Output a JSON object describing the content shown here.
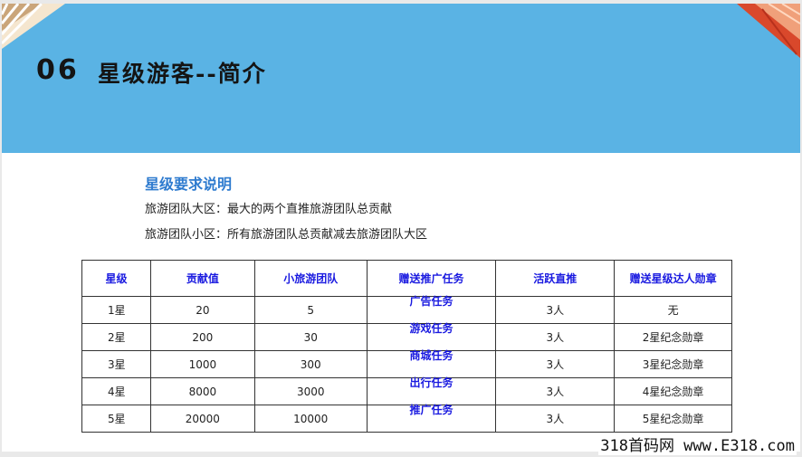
{
  "slide": {
    "number": "06",
    "title": "星级游客--简介",
    "accent_color": "#5ab3e4"
  },
  "section": {
    "heading": "星级要求说明",
    "lines": [
      "旅游团队大区：最大的两个直推旅游团队总贡献",
      "旅游团队小区：所有旅游团队总贡献减去旅游团队大区"
    ]
  },
  "table": {
    "headers": [
      "星级",
      "贡献值",
      "小旅游团队",
      "赠送推广任务",
      "活跃直推",
      "赠送星级达人勋章"
    ],
    "rows": [
      [
        "1星",
        "20",
        "5",
        "广告任务",
        "3人",
        "无"
      ],
      [
        "2星",
        "200",
        "30",
        "游戏任务",
        "3人",
        "2星纪念勋章"
      ],
      [
        "3星",
        "1000",
        "300",
        "商城任务",
        "3人",
        "3星纪念勋章"
      ],
      [
        "4星",
        "8000",
        "3000",
        "出行任务",
        "3人",
        "4星纪念勋章"
      ],
      [
        "5星",
        "20000",
        "10000",
        "推广任务",
        "3人",
        "5星纪念勋章"
      ]
    ]
  },
  "watermark": "318首码网 www.E318.com"
}
